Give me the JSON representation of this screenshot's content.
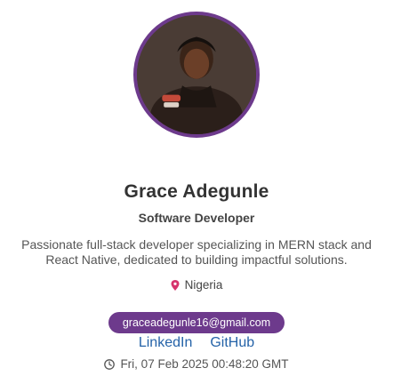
{
  "profile": {
    "name": "Grace Adegunle",
    "title": "Software Developer",
    "bio": "Passionate full-stack developer specializing in MERN stack and React Native, dedicated to building impactful solutions.",
    "location": "Nigeria",
    "email": "graceadegunle16@gmail.com",
    "links": {
      "linkedin": "LinkedIn",
      "github": "GitHub"
    },
    "timestamp": "Fri, 07 Feb 2025 00:48:20 GMT"
  },
  "icons": {
    "location": "map-pin-icon",
    "time": "clock-icon"
  },
  "colors": {
    "accent": "#6d3a8c",
    "link": "#2563a8",
    "pin": "#d6336c"
  }
}
